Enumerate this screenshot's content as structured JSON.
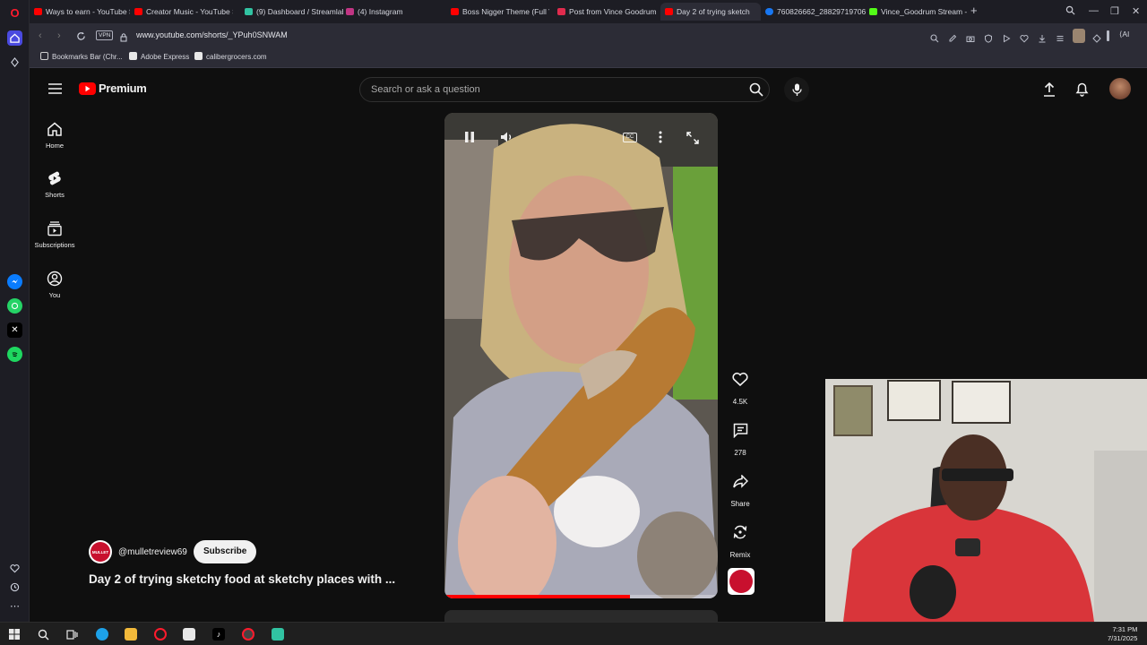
{
  "browser": {
    "tabs": [
      {
        "title": "Ways to earn - YouTube S",
        "color": "#ff0000",
        "active": false
      },
      {
        "title": "Creator Music - YouTube S",
        "color": "#ff0000",
        "active": false
      },
      {
        "title": "(9) Dashboard / Streamlab",
        "color": "#31c3a2",
        "active": false
      },
      {
        "title": "(4) Instagram",
        "color": "#c13584",
        "active": false
      },
      {
        "title": "Boss Nigger Theme (Full V",
        "color": "#ff0000",
        "active": false
      },
      {
        "title": "Post from Vince Goodrum",
        "color": "#e02b4d",
        "active": false
      },
      {
        "title": "Day 2 of trying sketch",
        "color": "#ff0000",
        "active": true
      },
      {
        "title": "760826662_28829719706",
        "color": "#1877f2",
        "active": false
      },
      {
        "title": "Vince_Goodrum Stream -",
        "color": "#53fc18",
        "active": false
      }
    ],
    "new_tab": "+",
    "vpn_badge": "VPN",
    "url": "www.youtube.com/shorts/_YPuh0SNWAM",
    "bookmarks": [
      {
        "label": "Bookmarks Bar (Chr...",
        "color": "#cfcfcf"
      },
      {
        "label": "Adobe Express",
        "color": "#e8e8e8"
      },
      {
        "label": "calibergrocers.com",
        "color": "#e8e8e8"
      }
    ],
    "ai_label": "AI"
  },
  "youtube": {
    "logo_text": "Premium",
    "search_placeholder": "Search or ask a question",
    "nav": [
      {
        "label": "Home",
        "icon": "home-icon"
      },
      {
        "label": "Shorts",
        "icon": "shorts-icon"
      },
      {
        "label": "Subscriptions",
        "icon": "subscriptions-icon"
      },
      {
        "label": "You",
        "icon": "you-icon"
      }
    ],
    "actions": {
      "like_count": "4.5K",
      "comment_count": "278",
      "share_label": "Share",
      "remix_label": "Remix"
    },
    "channel": {
      "handle": "@mulletreview69",
      "subscribe_label": "Subscribe",
      "avatar_text": "MULLET"
    },
    "video_title": "Day 2 of trying sketchy food at sketchy places with ...",
    "progress": 0.68
  },
  "taskbar": {
    "time": "7:31 PM",
    "date": "7/31/2025"
  },
  "colors": {
    "youtube_red": "#ff0000",
    "background": "#0f0f0f",
    "browser_chrome": "#2c2c36"
  }
}
